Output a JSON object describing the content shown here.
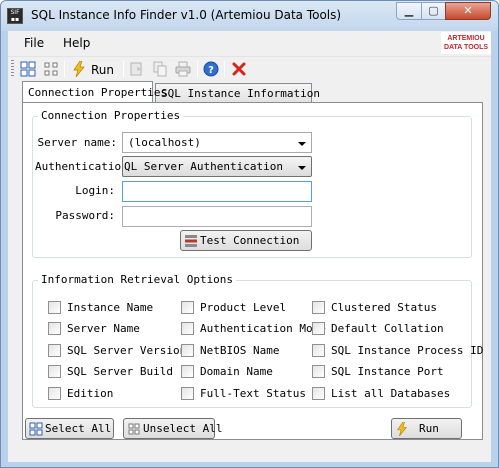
{
  "window": {
    "title": "SQL Instance Info Finder v1.0 (Artemiou Data Tools)"
  },
  "logo": {
    "line1": "ARTEMIOU",
    "line2": "DATA TOOLS"
  },
  "menu": [
    {
      "label": "File"
    },
    {
      "label": "Help"
    }
  ],
  "toolbar": {
    "run_label": "Run"
  },
  "tabs": [
    {
      "label": "Connection Properties",
      "active": true
    },
    {
      "label": "SQL Instance Information",
      "active": false
    }
  ],
  "connection": {
    "title": "Connection Properties",
    "server_label": "Server name:",
    "server_value": "(localhost)",
    "auth_label": "Authentication:",
    "auth_value": "QL Server Authentication",
    "login_label": "Login:",
    "login_value": "",
    "password_label": "Password:",
    "password_value": "",
    "test_button": "Test Connection"
  },
  "options": {
    "title": "Information Retrieval Options",
    "columns": [
      [
        "Instance Name",
        "Server Name",
        "SQL Server Version",
        "SQL Server Build",
        "Edition"
      ],
      [
        "Product Level",
        "Authentication Mode",
        "NetBIOS Name",
        "Domain Name",
        "Full-Text Status"
      ],
      [
        "Clustered Status",
        "Default Collation",
        "SQL Instance Process ID",
        "SQL Instance Port",
        "List all Databases"
      ]
    ]
  },
  "buttons": {
    "select_all": "Select All",
    "unselect_all": "Unselect All",
    "run": "Run"
  },
  "colors": {
    "accent": "#c0282d",
    "title_bar": "#c2d6ec",
    "close_button": "#c74a2c"
  }
}
